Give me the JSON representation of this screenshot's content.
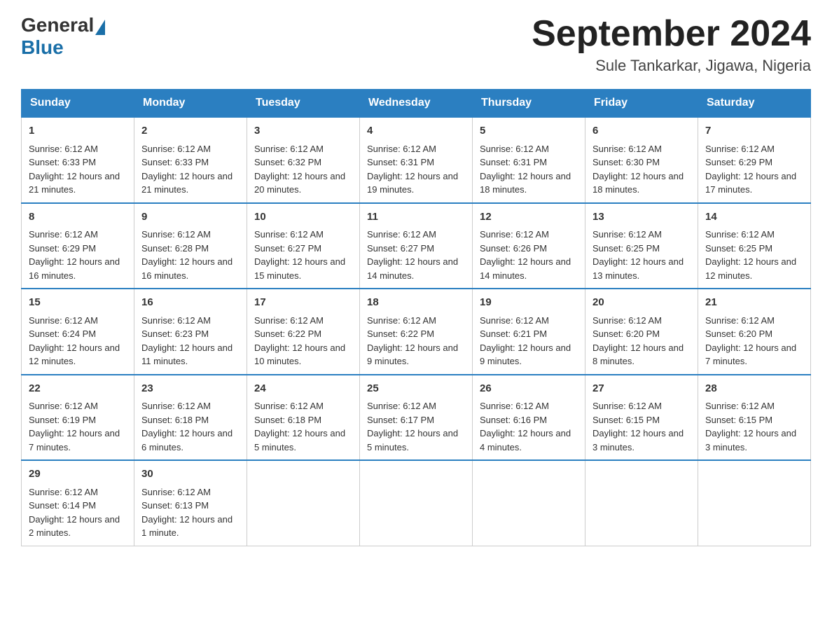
{
  "header": {
    "title": "September 2024",
    "subtitle": "Sule Tankarkar, Jigawa, Nigeria"
  },
  "logo": {
    "general": "General",
    "blue": "Blue"
  },
  "days": [
    "Sunday",
    "Monday",
    "Tuesday",
    "Wednesday",
    "Thursday",
    "Friday",
    "Saturday"
  ],
  "weeks": [
    [
      {
        "number": "1",
        "sunrise": "Sunrise: 6:12 AM",
        "sunset": "Sunset: 6:33 PM",
        "daylight": "Daylight: 12 hours and 21 minutes."
      },
      {
        "number": "2",
        "sunrise": "Sunrise: 6:12 AM",
        "sunset": "Sunset: 6:33 PM",
        "daylight": "Daylight: 12 hours and 21 minutes."
      },
      {
        "number": "3",
        "sunrise": "Sunrise: 6:12 AM",
        "sunset": "Sunset: 6:32 PM",
        "daylight": "Daylight: 12 hours and 20 minutes."
      },
      {
        "number": "4",
        "sunrise": "Sunrise: 6:12 AM",
        "sunset": "Sunset: 6:31 PM",
        "daylight": "Daylight: 12 hours and 19 minutes."
      },
      {
        "number": "5",
        "sunrise": "Sunrise: 6:12 AM",
        "sunset": "Sunset: 6:31 PM",
        "daylight": "Daylight: 12 hours and 18 minutes."
      },
      {
        "number": "6",
        "sunrise": "Sunrise: 6:12 AM",
        "sunset": "Sunset: 6:30 PM",
        "daylight": "Daylight: 12 hours and 18 minutes."
      },
      {
        "number": "7",
        "sunrise": "Sunrise: 6:12 AM",
        "sunset": "Sunset: 6:29 PM",
        "daylight": "Daylight: 12 hours and 17 minutes."
      }
    ],
    [
      {
        "number": "8",
        "sunrise": "Sunrise: 6:12 AM",
        "sunset": "Sunset: 6:29 PM",
        "daylight": "Daylight: 12 hours and 16 minutes."
      },
      {
        "number": "9",
        "sunrise": "Sunrise: 6:12 AM",
        "sunset": "Sunset: 6:28 PM",
        "daylight": "Daylight: 12 hours and 16 minutes."
      },
      {
        "number": "10",
        "sunrise": "Sunrise: 6:12 AM",
        "sunset": "Sunset: 6:27 PM",
        "daylight": "Daylight: 12 hours and 15 minutes."
      },
      {
        "number": "11",
        "sunrise": "Sunrise: 6:12 AM",
        "sunset": "Sunset: 6:27 PM",
        "daylight": "Daylight: 12 hours and 14 minutes."
      },
      {
        "number": "12",
        "sunrise": "Sunrise: 6:12 AM",
        "sunset": "Sunset: 6:26 PM",
        "daylight": "Daylight: 12 hours and 14 minutes."
      },
      {
        "number": "13",
        "sunrise": "Sunrise: 6:12 AM",
        "sunset": "Sunset: 6:25 PM",
        "daylight": "Daylight: 12 hours and 13 minutes."
      },
      {
        "number": "14",
        "sunrise": "Sunrise: 6:12 AM",
        "sunset": "Sunset: 6:25 PM",
        "daylight": "Daylight: 12 hours and 12 minutes."
      }
    ],
    [
      {
        "number": "15",
        "sunrise": "Sunrise: 6:12 AM",
        "sunset": "Sunset: 6:24 PM",
        "daylight": "Daylight: 12 hours and 12 minutes."
      },
      {
        "number": "16",
        "sunrise": "Sunrise: 6:12 AM",
        "sunset": "Sunset: 6:23 PM",
        "daylight": "Daylight: 12 hours and 11 minutes."
      },
      {
        "number": "17",
        "sunrise": "Sunrise: 6:12 AM",
        "sunset": "Sunset: 6:22 PM",
        "daylight": "Daylight: 12 hours and 10 minutes."
      },
      {
        "number": "18",
        "sunrise": "Sunrise: 6:12 AM",
        "sunset": "Sunset: 6:22 PM",
        "daylight": "Daylight: 12 hours and 9 minutes."
      },
      {
        "number": "19",
        "sunrise": "Sunrise: 6:12 AM",
        "sunset": "Sunset: 6:21 PM",
        "daylight": "Daylight: 12 hours and 9 minutes."
      },
      {
        "number": "20",
        "sunrise": "Sunrise: 6:12 AM",
        "sunset": "Sunset: 6:20 PM",
        "daylight": "Daylight: 12 hours and 8 minutes."
      },
      {
        "number": "21",
        "sunrise": "Sunrise: 6:12 AM",
        "sunset": "Sunset: 6:20 PM",
        "daylight": "Daylight: 12 hours and 7 minutes."
      }
    ],
    [
      {
        "number": "22",
        "sunrise": "Sunrise: 6:12 AM",
        "sunset": "Sunset: 6:19 PM",
        "daylight": "Daylight: 12 hours and 7 minutes."
      },
      {
        "number": "23",
        "sunrise": "Sunrise: 6:12 AM",
        "sunset": "Sunset: 6:18 PM",
        "daylight": "Daylight: 12 hours and 6 minutes."
      },
      {
        "number": "24",
        "sunrise": "Sunrise: 6:12 AM",
        "sunset": "Sunset: 6:18 PM",
        "daylight": "Daylight: 12 hours and 5 minutes."
      },
      {
        "number": "25",
        "sunrise": "Sunrise: 6:12 AM",
        "sunset": "Sunset: 6:17 PM",
        "daylight": "Daylight: 12 hours and 5 minutes."
      },
      {
        "number": "26",
        "sunrise": "Sunrise: 6:12 AM",
        "sunset": "Sunset: 6:16 PM",
        "daylight": "Daylight: 12 hours and 4 minutes."
      },
      {
        "number": "27",
        "sunrise": "Sunrise: 6:12 AM",
        "sunset": "Sunset: 6:15 PM",
        "daylight": "Daylight: 12 hours and 3 minutes."
      },
      {
        "number": "28",
        "sunrise": "Sunrise: 6:12 AM",
        "sunset": "Sunset: 6:15 PM",
        "daylight": "Daylight: 12 hours and 3 minutes."
      }
    ],
    [
      {
        "number": "29",
        "sunrise": "Sunrise: 6:12 AM",
        "sunset": "Sunset: 6:14 PM",
        "daylight": "Daylight: 12 hours and 2 minutes."
      },
      {
        "number": "30",
        "sunrise": "Sunrise: 6:12 AM",
        "sunset": "Sunset: 6:13 PM",
        "daylight": "Daylight: 12 hours and 1 minute."
      },
      null,
      null,
      null,
      null,
      null
    ]
  ]
}
